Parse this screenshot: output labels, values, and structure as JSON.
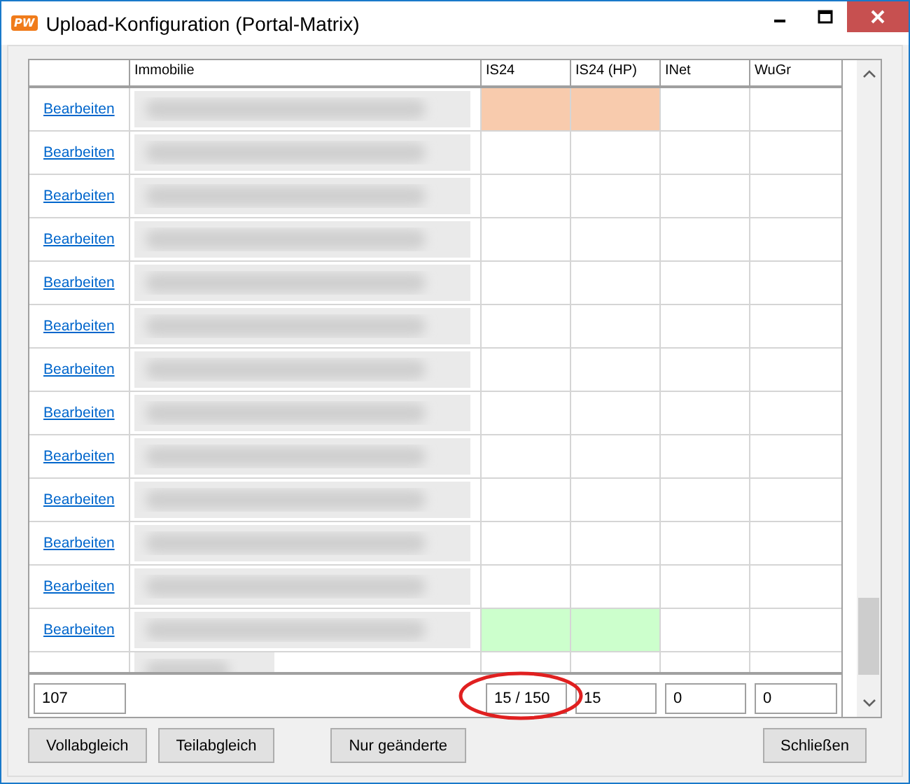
{
  "window": {
    "title": "Upload-Konfiguration (Portal-Matrix)",
    "app_icon": "PW"
  },
  "table": {
    "columns": [
      "Immobilie",
      "IS24",
      "IS24 (HP)",
      "INet",
      "WuGr"
    ],
    "rows": [
      {
        "link": "Bearbeiten",
        "color": "#f8cbad"
      },
      {
        "link": "Bearbeiten"
      },
      {
        "link": "Bearbeiten"
      },
      {
        "link": "Bearbeiten"
      },
      {
        "link": "Bearbeiten"
      },
      {
        "link": "Bearbeiten"
      },
      {
        "link": "Bearbeiten"
      },
      {
        "link": "Bearbeiten"
      },
      {
        "link": "Bearbeiten"
      },
      {
        "link": "Bearbeiten"
      },
      {
        "link": "Bearbeiten"
      },
      {
        "link": "Bearbeiten"
      },
      {
        "link": "Bearbeiten",
        "color": "#ccffcc"
      }
    ],
    "footer": {
      "count": "107",
      "totals": [
        "15 / 150",
        "15",
        "0",
        "0"
      ]
    }
  },
  "buttons": [
    "Vollabgleich",
    "Teilabgleich",
    "Nur geänderte",
    "Schließen"
  ]
}
